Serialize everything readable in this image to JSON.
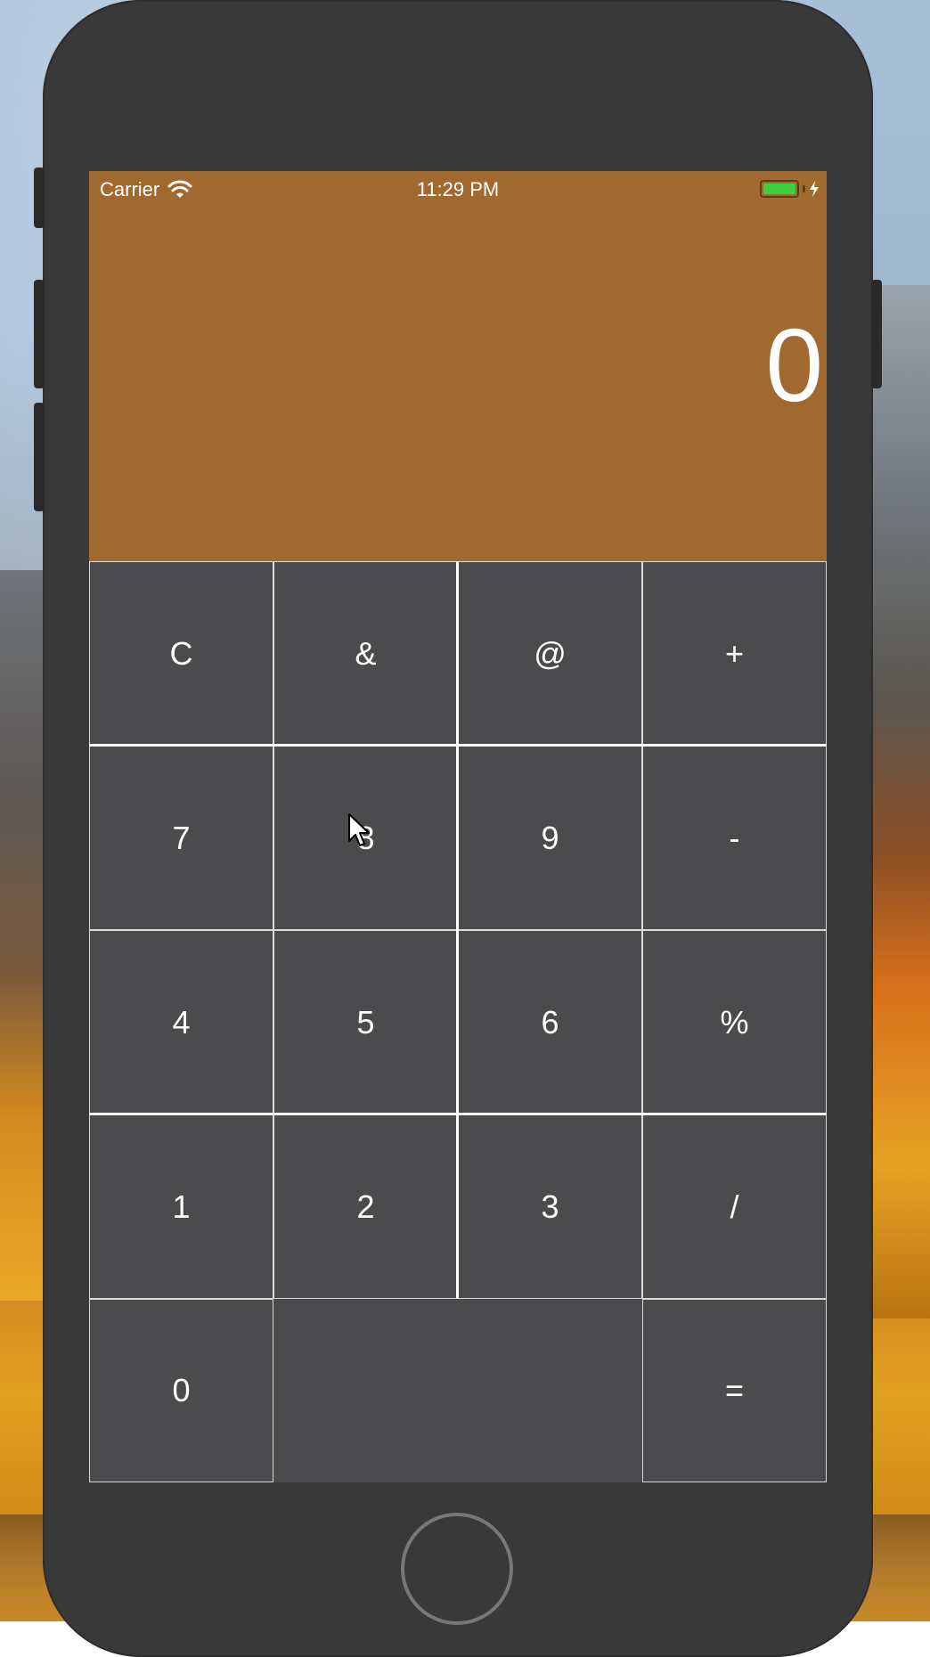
{
  "status_bar": {
    "carrier": "Carrier",
    "time": "11:29 PM",
    "wifi_icon": "wifi-icon",
    "battery_icon": "battery-icon",
    "charging_icon": "charging-bolt-icon"
  },
  "display": {
    "value": "0",
    "background": "#a0692f"
  },
  "keypad": {
    "rows": [
      [
        "C",
        "&",
        "@",
        "+"
      ],
      [
        "7",
        "8",
        "9",
        "-"
      ],
      [
        "4",
        "5",
        "6",
        "%"
      ],
      [
        "1",
        "2",
        "3",
        "/"
      ]
    ],
    "last_row": {
      "zero": "0",
      "blank": "",
      "equals": "="
    },
    "key_color": "#4b4a4c"
  },
  "device": {
    "home_button_icon": "home-button",
    "cursor_icon": "pointer-cursor-icon"
  }
}
